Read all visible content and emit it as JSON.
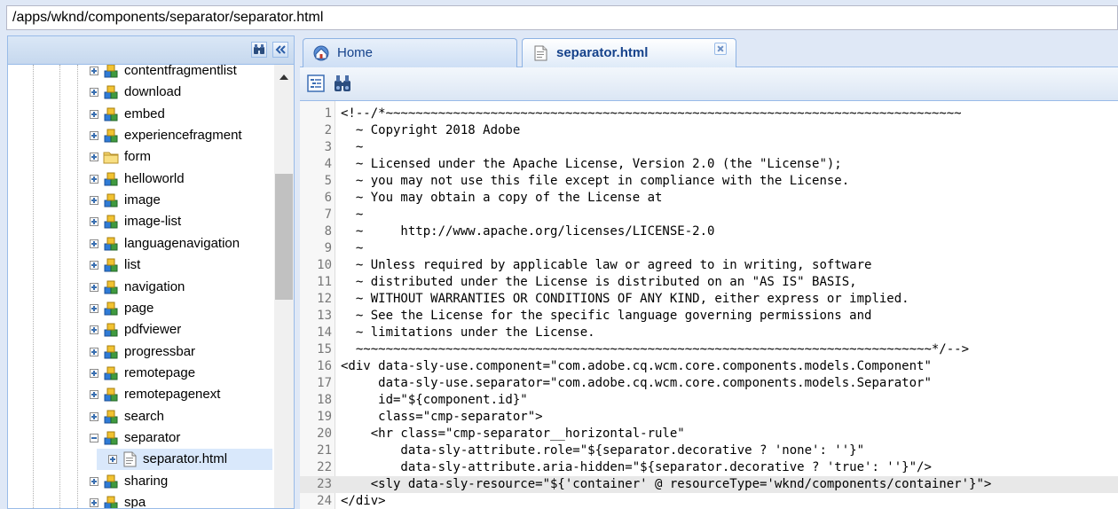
{
  "path_bar": {
    "value": "/apps/wknd/components/separator/separator.html"
  },
  "tree": {
    "items": [
      {
        "label": "contentfragmentlist",
        "type": "component",
        "expander": "plus",
        "depth": 0
      },
      {
        "label": "download",
        "type": "component",
        "expander": "plus",
        "depth": 0
      },
      {
        "label": "embed",
        "type": "component",
        "expander": "plus",
        "depth": 0
      },
      {
        "label": "experiencefragment",
        "type": "component",
        "expander": "plus",
        "depth": 0
      },
      {
        "label": "form",
        "type": "folder",
        "expander": "plus",
        "depth": 0
      },
      {
        "label": "helloworld",
        "type": "component",
        "expander": "plus",
        "depth": 0
      },
      {
        "label": "image",
        "type": "component",
        "expander": "plus",
        "depth": 0
      },
      {
        "label": "image-list",
        "type": "component",
        "expander": "plus",
        "depth": 0
      },
      {
        "label": "languagenavigation",
        "type": "component",
        "expander": "plus",
        "depth": 0
      },
      {
        "label": "list",
        "type": "component",
        "expander": "plus",
        "depth": 0
      },
      {
        "label": "navigation",
        "type": "component",
        "expander": "plus",
        "depth": 0
      },
      {
        "label": "page",
        "type": "component",
        "expander": "plus",
        "depth": 0
      },
      {
        "label": "pdfviewer",
        "type": "component",
        "expander": "plus",
        "depth": 0
      },
      {
        "label": "progressbar",
        "type": "component",
        "expander": "plus",
        "depth": 0
      },
      {
        "label": "remotepage",
        "type": "component",
        "expander": "plus",
        "depth": 0
      },
      {
        "label": "remotepagenext",
        "type": "component",
        "expander": "plus",
        "depth": 0
      },
      {
        "label": "search",
        "type": "component",
        "expander": "plus",
        "depth": 0
      },
      {
        "label": "separator",
        "type": "component",
        "expander": "minus",
        "depth": 0
      },
      {
        "label": "separator.html",
        "type": "file",
        "expander": "plus",
        "depth": 1,
        "selected": true
      },
      {
        "label": "sharing",
        "type": "component",
        "expander": "plus",
        "depth": 0
      },
      {
        "label": "spa",
        "type": "component",
        "expander": "plus",
        "depth": 0
      }
    ]
  },
  "tabs": [
    {
      "label": "Home",
      "icon": "home-icon",
      "active": false,
      "closable": false
    },
    {
      "label": "separator.html",
      "icon": "file-icon",
      "active": true,
      "closable": true
    }
  ],
  "toolbar": {
    "buttons": [
      "outline-icon",
      "find-replace-icon"
    ]
  },
  "editor": {
    "highlighted_line": 23,
    "lines": [
      "<!--/*~~~~~~~~~~~~~~~~~~~~~~~~~~~~~~~~~~~~~~~~~~~~~~~~~~~~~~~~~~~~~~~~~~~~~~~~~~~~~",
      "  ~ Copyright 2018 Adobe",
      "  ~",
      "  ~ Licensed under the Apache License, Version 2.0 (the \"License\");",
      "  ~ you may not use this file except in compliance with the License.",
      "  ~ You may obtain a copy of the License at",
      "  ~",
      "  ~     http://www.apache.org/licenses/LICENSE-2.0",
      "  ~",
      "  ~ Unless required by applicable law or agreed to in writing, software",
      "  ~ distributed under the License is distributed on an \"AS IS\" BASIS,",
      "  ~ WITHOUT WARRANTIES OR CONDITIONS OF ANY KIND, either express or implied.",
      "  ~ See the License for the specific language governing permissions and",
      "  ~ limitations under the License.",
      "  ~~~~~~~~~~~~~~~~~~~~~~~~~~~~~~~~~~~~~~~~~~~~~~~~~~~~~~~~~~~~~~~~~~~~~~~~~~~~~*/-->",
      "<div data-sly-use.component=\"com.adobe.cq.wcm.core.components.models.Component\"",
      "     data-sly-use.separator=\"com.adobe.cq.wcm.core.components.models.Separator\"",
      "     id=\"${component.id}\"",
      "     class=\"cmp-separator\">",
      "    <hr class=\"cmp-separator__horizontal-rule\"",
      "        data-sly-attribute.role=\"${separator.decorative ? 'none': ''}\"",
      "        data-sly-attribute.aria-hidden=\"${separator.decorative ? 'true': ''}\"/>",
      "    <sly data-sly-resource=\"${'container' @ resourceType='wknd/components/container'}\">",
      "</div>"
    ]
  }
}
